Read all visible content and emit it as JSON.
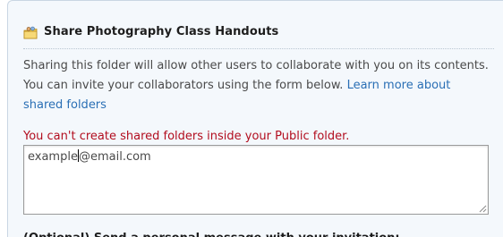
{
  "dialog": {
    "title": "Share Photography Class Handouts",
    "icon": "shared-folder-icon",
    "description_text": "Sharing this folder will allow other users to collaborate with you on its contents. You can invite your collaborators using the form below.",
    "learn_more_link": "Learn more about shared folders",
    "error_message": "You can't create shared folders inside your Public folder.",
    "invite_input": {
      "value_before_caret": "example",
      "value_after_caret": "@email.com"
    },
    "optional_heading": "(Optional) Send a personal message with your invitation:",
    "colors": {
      "link": "#2a6fb5",
      "error": "#b20d1e",
      "background": "#f4f8fc"
    }
  }
}
